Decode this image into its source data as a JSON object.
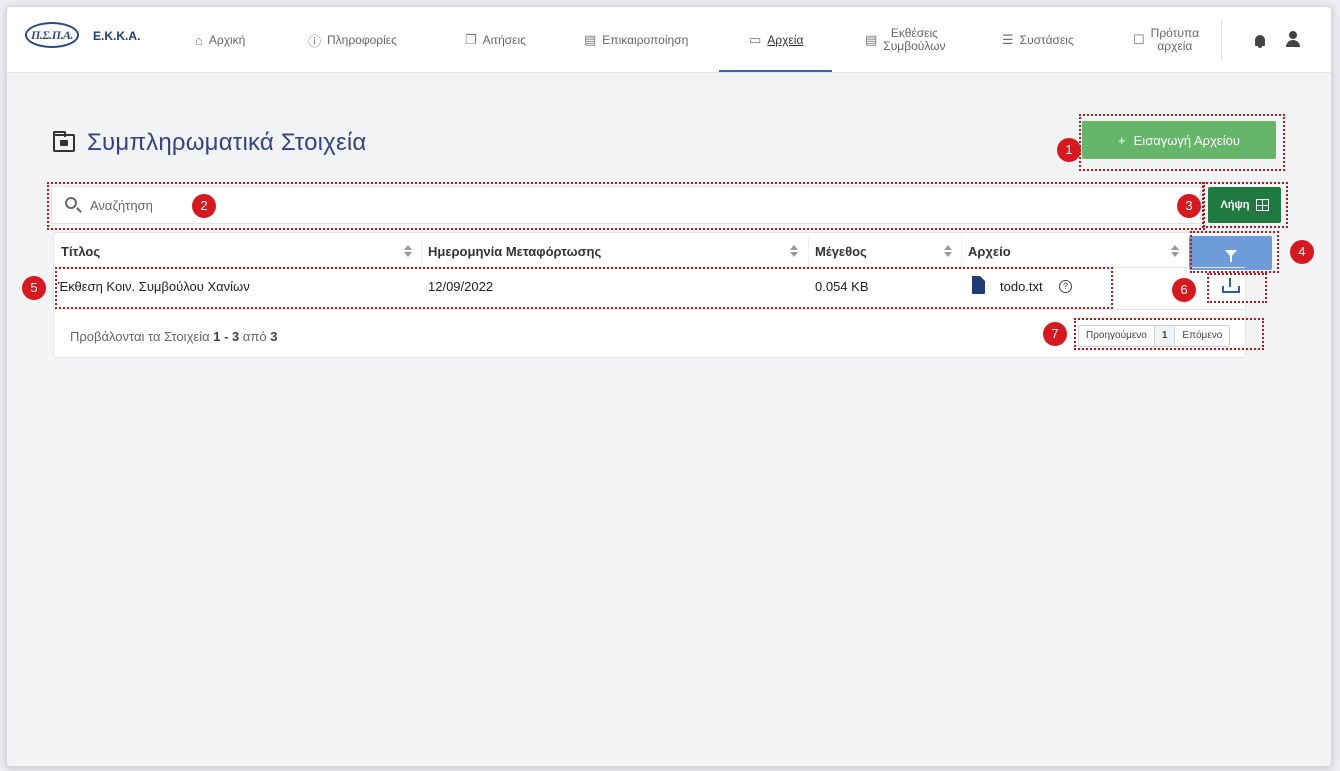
{
  "nav": {
    "logo_text": "Π.Σ.Π.Α.",
    "brand": "Ε.Κ.Κ.Α.",
    "items": [
      {
        "label": "Αρχική",
        "icon": "home-icon"
      },
      {
        "label": "Πληροφορίες",
        "icon": "info-icon"
      },
      {
        "label": "Αιτήσεις",
        "icon": "copy-icon"
      },
      {
        "label": "Επικαιροποίηση",
        "icon": "clipboard-icon"
      },
      {
        "label": "Αρχεία",
        "icon": "folder-icon",
        "active": true
      },
      {
        "label_line1": "Εκθέσεις",
        "label_line2": "Συμβούλων",
        "icon": "document-icon"
      },
      {
        "label": "Συστάσεις",
        "icon": "checklist-icon"
      },
      {
        "label_line1": "Πρότυπα",
        "label_line2": "αρχεία",
        "icon": "file-icon"
      }
    ]
  },
  "page": {
    "title": "Συμπληρωματικά Στοιχεία",
    "add_button": "Εισαγωγή Αρχείου",
    "add_button_icon": "+",
    "search_placeholder": "Αναζήτηση",
    "excel_button": "Λήψη"
  },
  "table": {
    "headers": [
      "Τίτλος",
      "Ημερομηνία Μεταφόρτωσης",
      "Μέγεθος",
      "Αρχείο"
    ],
    "rows": [
      {
        "title": "Έκθεση Κοιν. Συμβούλου Χανίων",
        "date": "12/09/2022",
        "size": "0.054 KB",
        "file": "todo.txt",
        "help": "?"
      }
    ],
    "footer_prefix": "Προβάλονται τα Στοιχεία",
    "footer_from": "1",
    "footer_dash": " - ",
    "footer_to": "3",
    "footer_of": " από ",
    "footer_total": "3"
  },
  "pagination": {
    "prev": "Προηγούμενο",
    "current": "1",
    "next": "Επόμενο"
  },
  "badges": [
    "1",
    "2",
    "3",
    "4",
    "5",
    "6",
    "7"
  ],
  "colors": {
    "primary_green": "#65b66a",
    "excel_green": "#1e7a3e",
    "filter_blue": "#6d9cd9",
    "annotation_red": "#d7191f",
    "title_blue": "#34428a"
  }
}
